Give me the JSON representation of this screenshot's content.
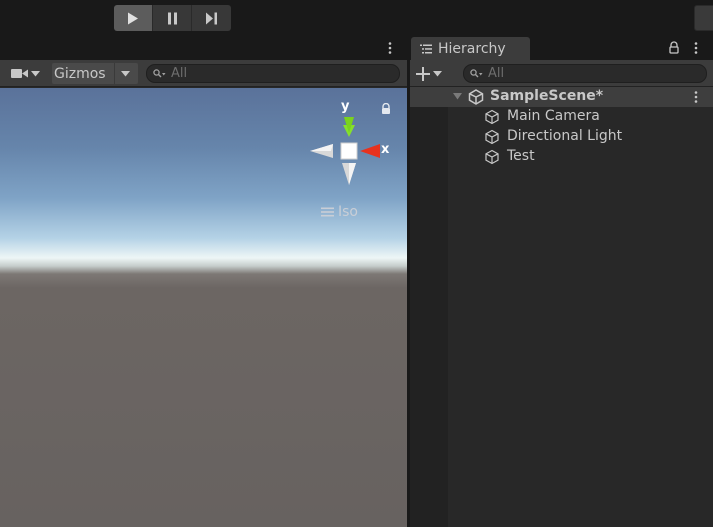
{
  "toolbar": {
    "play_icon": "play-icon",
    "pause_icon": "pause-icon",
    "step_icon": "step-icon"
  },
  "scene_view": {
    "camera_icon": "camera-icon",
    "gizmos_label": "Gizmos",
    "search_placeholder": "All",
    "gizmo": {
      "y_label": "y",
      "x_label": "x"
    },
    "projection_label": "Iso",
    "colors": {
      "y_axis": "#7ad31e",
      "x_axis": "#e8321e"
    }
  },
  "hierarchy": {
    "tab_label": "Hierarchy",
    "search_placeholder": "All",
    "scene": {
      "name": "SampleScene*"
    },
    "objects": [
      {
        "name": "Main Camera"
      },
      {
        "name": "Directional Light"
      },
      {
        "name": "Test"
      }
    ]
  }
}
